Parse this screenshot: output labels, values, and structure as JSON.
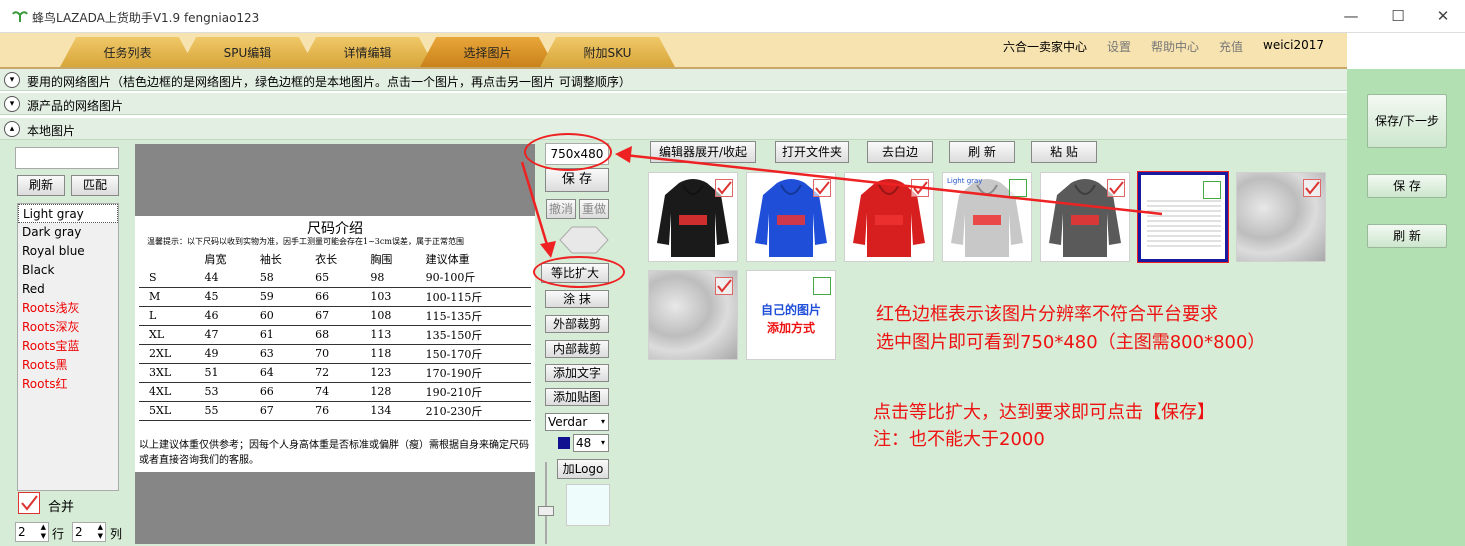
{
  "app": {
    "title": "蜂鸟LAZADA上货助手V1.9  fengniao123"
  },
  "window_controls": {
    "minimize": "—",
    "maximize": "☐",
    "close": "✕"
  },
  "tabs": [
    {
      "label": "任务列表"
    },
    {
      "label": "SPU编辑"
    },
    {
      "label": "详情编辑"
    },
    {
      "label": "选择图片"
    },
    {
      "label": "附加SKU"
    }
  ],
  "top_links": {
    "seller_center": "六合一卖家中心",
    "settings": "设置",
    "help": "帮助中心",
    "recharge": "充值",
    "user": "weici2017"
  },
  "sections": {
    "used_images": "要用的网络图片（桔色边框的是网络图片，绿色边框的是本地图片。点击一个图片，再点击另一图片 可调整顺序）",
    "source_images": "源产品的网络图片",
    "local_images": "本地图片"
  },
  "right_buttons": {
    "save_next": "保存/下一步",
    "save": "保 存",
    "refresh": "刷 新"
  },
  "left_panel": {
    "search_value": "",
    "refresh": "刷新",
    "match": "匹配",
    "colors": [
      {
        "label": "Light gray",
        "color": "#000"
      },
      {
        "label": "Dark gray",
        "color": "#000"
      },
      {
        "label": "Royal blue",
        "color": "#000"
      },
      {
        "label": "Black",
        "color": "#000"
      },
      {
        "label": "Red",
        "color": "#000"
      },
      {
        "label": "Roots浅灰",
        "color": "#e00"
      },
      {
        "label": "Roots深灰",
        "color": "#e00"
      },
      {
        "label": "Roots宝蓝",
        "color": "#e00"
      },
      {
        "label": "Roots黑",
        "color": "#e00"
      },
      {
        "label": "Roots红",
        "color": "#e00"
      }
    ],
    "merge_label": "合并",
    "rows_value": "2",
    "rows_label": "行",
    "cols_value": "2",
    "cols_label": "列"
  },
  "size_chart": {
    "title": "尺码介绍",
    "tip": "温馨提示：以下尺码以收到实物为准，因手工测量可能会存在1~3cm误差，属于正常范围",
    "headers": [
      "",
      "肩宽",
      "袖长",
      "衣长",
      "胸围",
      "建议体重"
    ],
    "rows": [
      [
        "S",
        "44",
        "58",
        "65",
        "98",
        "90-100斤"
      ],
      [
        "M",
        "45",
        "59",
        "66",
        "103",
        "100-115斤"
      ],
      [
        "L",
        "46",
        "60",
        "67",
        "108",
        "115-135斤"
      ],
      [
        "XL",
        "47",
        "61",
        "68",
        "113",
        "135-150斤"
      ],
      [
        "2XL",
        "49",
        "63",
        "70",
        "118",
        "150-170斤"
      ],
      [
        "3XL",
        "51",
        "64",
        "72",
        "123",
        "170-190斤"
      ],
      [
        "4XL",
        "53",
        "66",
        "74",
        "128",
        "190-210斤"
      ],
      [
        "5XL",
        "55",
        "67",
        "76",
        "134",
        "210-230斤"
      ]
    ],
    "note": "以上建议体重仅供参考；因每个人身高体重是否标准或偏胖（瘦）需根据自身来确定尺码或者直接咨询我们的客服。"
  },
  "edit_tools": {
    "resolution": "750x480",
    "save": "保 存",
    "undo": "撤消",
    "redo": "重做",
    "scale_up": "等比扩大",
    "smear": "涂 抹",
    "outer_crop": "外部裁剪",
    "inner_crop": "内部裁剪",
    "add_text": "添加文字",
    "add_sticker": "添加贴图",
    "font": "Verdar",
    "font_size": "48",
    "add_logo": "加Logo"
  },
  "gallery_buttons": {
    "toggle_editor": "编辑器展开/收起",
    "open_folder": "打开文件夹",
    "remove_border": "去白边",
    "refresh": "刷 新",
    "paste": "粘 贴"
  },
  "thumbs": [
    {
      "type": "hoodie",
      "color": "#1a1a1a"
    },
    {
      "type": "hoodie",
      "color": "#1f4fd8"
    },
    {
      "type": "hoodie",
      "color": "#d81f1f"
    },
    {
      "type": "hoodie",
      "color": "#c8c8c8",
      "label": "Light gray"
    },
    {
      "type": "hoodie",
      "color": "#5a5a5a"
    },
    {
      "type": "sizechart",
      "selected": true
    },
    {
      "type": "fabric"
    },
    {
      "type": "fabric"
    },
    {
      "type": "custom",
      "line1": "自己的图片",
      "line2": "添加方式"
    }
  ],
  "annotations": {
    "line1": "红色边框表示该图片分辨率不符合平台要求",
    "line2": "选中图片即可看到750*480（主图需800*800）",
    "line3": "点击等比扩大，达到要求即可点击【保存】",
    "line4": "注：也不能大于2000"
  },
  "colors": {
    "annotation": "#e11",
    "tab_active": "#d8902a",
    "panel_green": "#d7ecd7"
  }
}
